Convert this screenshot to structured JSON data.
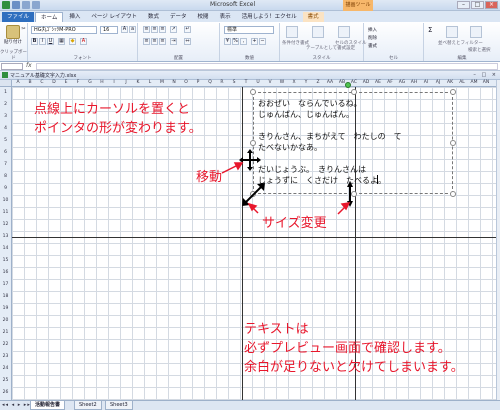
{
  "app": {
    "title": "Microsoft Excel",
    "contextual_group": "描画ツール"
  },
  "tabs": [
    {
      "label": "ファイル",
      "kind": "file"
    },
    {
      "label": "ホーム",
      "kind": "active"
    },
    {
      "label": "挿入",
      "kind": "normal"
    },
    {
      "label": "ページ レイアウト",
      "kind": "normal"
    },
    {
      "label": "数式",
      "kind": "normal"
    },
    {
      "label": "データ",
      "kind": "normal"
    },
    {
      "label": "校閲",
      "kind": "normal"
    },
    {
      "label": "表示",
      "kind": "normal"
    },
    {
      "label": "活用しよう！エクセル",
      "kind": "normal"
    },
    {
      "label": "書式",
      "kind": "ctx"
    }
  ],
  "ribbon": {
    "paste_label": "貼り付け",
    "clipboard_label": "クリップボード",
    "font_name": "HG丸ｺﾞｼｯｸM-PRO",
    "font_size": "16",
    "font_group_label": "フォント",
    "align_group_label": "配置",
    "number_format": "標準",
    "number_group_label": "数値",
    "style_group_label": "スタイル",
    "cells_group_label": "セル",
    "edit_group_label": "編集",
    "style_buttons": [
      "条件付き書式",
      "テーブルとして書式設定",
      "セルのスタイル"
    ],
    "cell_buttons": [
      "挿入",
      "削除",
      "書式"
    ],
    "sum_label": "Σ",
    "sort_label": "並べ替えとフィルター",
    "find_label": "検索と選択"
  },
  "document": {
    "name": "マニュアル基礎文字入力.xlsx"
  },
  "columns": [
    "A",
    "B",
    "C",
    "D",
    "E",
    "F",
    "G",
    "H",
    "I",
    "J",
    "K",
    "L",
    "M",
    "N",
    "O",
    "P",
    "Q",
    "R",
    "S",
    "T",
    "U",
    "V",
    "W",
    "X",
    "Y",
    "Z",
    "AA",
    "AB",
    "AC",
    "AD",
    "AE",
    "AF",
    "AG",
    "AH",
    "AI",
    "AJ",
    "AK",
    "AL",
    "AM",
    "AN"
  ],
  "rows": [
    "1",
    "2",
    "3",
    "4",
    "5",
    "6",
    "7",
    "8",
    "9",
    "10",
    "11",
    "12",
    "13",
    "14",
    "15",
    "16",
    "17",
    "18",
    "19",
    "20",
    "21",
    "22",
    "23",
    "24",
    "25",
    "26"
  ],
  "textbox": {
    "lines": [
      "おおぜい　ならんでいるね。",
      "じゅんばん、じゅんばん。",
      "",
      "きりんさん、まちがえて　わたしの　て",
      "たべないかなあ。",
      "",
      "だいじょうぶ。　きりんさんは",
      "じょうずに　くさだけ　たべるよ。"
    ]
  },
  "annotations": {
    "top_line1": "点線上にカーソルを置くと",
    "top_line2": "ポインタの形が変わります。",
    "move": "移動",
    "resize": "サイズ変更",
    "bottom_line1": "テキストは",
    "bottom_line2": "必ずプレビュー画面で確認します。",
    "bottom_line3": "余白が足りないと欠けてしまいます。",
    "color": "#e8172c"
  },
  "sheets": [
    "活動報告書",
    "Sheet2",
    "Sheet3"
  ]
}
